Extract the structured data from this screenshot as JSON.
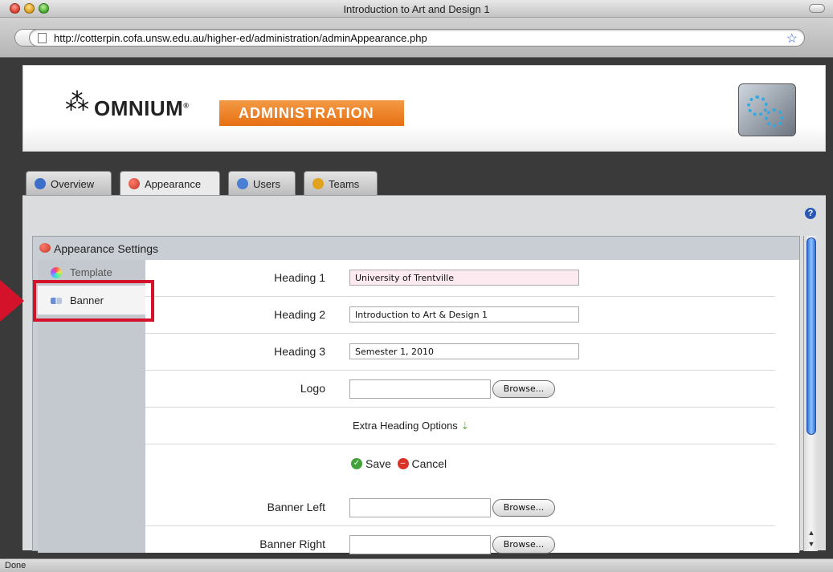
{
  "window": {
    "title": "Introduction to Art and Design 1"
  },
  "address": {
    "url": "http://cotterpin.cofa.unsw.edu.au/higher-ed/administration/adminAppearance.php"
  },
  "banner": {
    "logo": "OMNIUM",
    "logo_mark": "⁂",
    "registered": "®",
    "badge": "ADMINISTRATION"
  },
  "tabs": [
    {
      "label": "Overview",
      "icon": "info-icon",
      "color": "#3b6fc9"
    },
    {
      "label": "Appearance",
      "icon": "palette-icon",
      "color": "#d9453a",
      "active": true
    },
    {
      "label": "Users",
      "icon": "users-icon",
      "color": "#4a7fd4"
    },
    {
      "label": "Teams",
      "icon": "teams-icon",
      "color": "#e0a21f"
    }
  ],
  "settings": {
    "title": "Appearance Settings",
    "nav": [
      {
        "label": "Template",
        "icon": "color-wheel-icon"
      },
      {
        "label": "Banner",
        "icon": "banner-icon",
        "selected": true
      }
    ],
    "fields": {
      "heading1": {
        "label": "Heading 1",
        "value": "University of Trentville"
      },
      "heading2": {
        "label": "Heading 2",
        "value": "Introduction to Art & Design 1"
      },
      "heading3": {
        "label": "Heading 3",
        "value": "Semester 1, 2010"
      },
      "logo": {
        "label": "Logo",
        "button": "Browse..."
      },
      "extra": {
        "label": "Extra Heading Options"
      },
      "save": "Save",
      "cancel": "Cancel",
      "banner_left": {
        "label": "Banner Left",
        "button": "Browse..."
      },
      "banner_right": {
        "label": "Banner Right",
        "button": "Browse..."
      }
    }
  },
  "help": "?",
  "status": "Done",
  "colors": {
    "accent_orange": "#e76f13",
    "highlight_red": "#d4132a",
    "scroll_blue": "#2f6fd8"
  }
}
